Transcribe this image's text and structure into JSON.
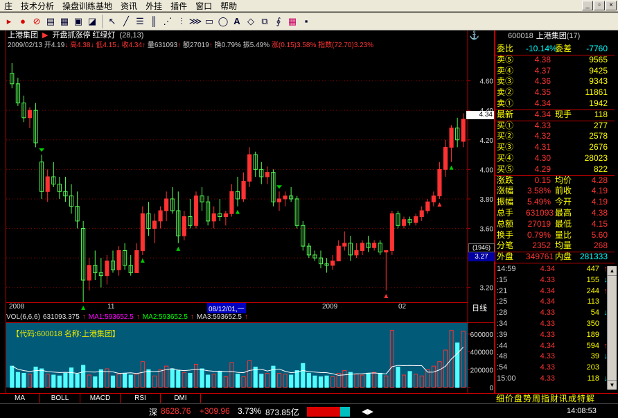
{
  "menu": {
    "items": [
      "庄",
      "技术分析",
      "操盘训练基地",
      "资讯",
      "外挂",
      "插件",
      "窗口",
      "帮助"
    ]
  },
  "window_controls": [
    "_",
    "▫",
    "×"
  ],
  "toolbar": {
    "icons": [
      "pointer-icon",
      "alarm-icon",
      "stop-icon",
      "grid-icon",
      "table-icon",
      "window-icon",
      "chart-icon",
      "cursor-icon",
      "line-icon",
      "channel-icon",
      "parallel-icon",
      "fan-icon",
      "gann-icon",
      "cycle-icon",
      "rectangle-icon",
      "ellipse-icon",
      "text-icon",
      "eraser-icon",
      "copy-icon",
      "formula-icon",
      "palette-icon",
      "save-icon"
    ]
  },
  "chart": {
    "title_stock": "上港集团",
    "title_indicator": "开盘抓涨停 红绿灯",
    "title_params": "(28,13)",
    "info_date": "2009/02/13",
    "info_open_label": "开",
    "info_open": "4.19",
    "info_high_label": "高",
    "info_high": "4.38",
    "info_low_label": "低",
    "info_low": "4.15",
    "info_close_label": "收",
    "info_close": "4.34",
    "info_vol_label": "量",
    "info_vol": "631093",
    "info_amount_label": "额",
    "info_amount": "27019",
    "info_turn_label": "换",
    "info_turn": "0.79%",
    "info_amp_label": "振",
    "info_amp": "5.49%",
    "info_chg_label": "涨",
    "info_chg": "(0.15)",
    "info_chg_pct": "3.58%",
    "info_index_label": "指数",
    "info_index": "(72.70)",
    "info_index_pct": "3.23%",
    "yaxis_labels": [
      "4.60",
      "4.40",
      "4.20",
      "4.00",
      "3.80",
      "3.60",
      "3.40",
      "3.20"
    ],
    "yaxis_values": [
      4.6,
      4.4,
      4.2,
      4.0,
      3.8,
      3.6,
      3.4,
      3.2
    ],
    "price_tag": "4.34",
    "price_tag_value": 4.34,
    "left_tag_1": "(1946)",
    "left_tag_2": "3.27",
    "xaxis_labels": [
      "2008",
      "11",
      "08/12/01,一",
      "2009",
      "02"
    ],
    "period_label": "日线",
    "vol_header": "VOL(6,6,6)",
    "vol_value": "631093.375",
    "ma1_label": "MA1:593652.5",
    "ma2_label": "MA2:593652.5",
    "ma3_label": "MA3:593652.5",
    "vol_panel_label": "【代码:600018 名称:上港集团】",
    "vol_axis_labels": [
      "600000",
      "400000",
      "200000",
      "0"
    ],
    "vol_axis_values": [
      600000,
      400000,
      200000,
      0
    ],
    "colors": {
      "up": "#ff3232",
      "down": "#54fcfc",
      "green_bar": "#54fc54",
      "grid": "#8b0000",
      "axis": "#b00000"
    }
  },
  "chart_data": [
    {
      "type": "candlestick",
      "title": "上港集团",
      "ylim": [
        3.1,
        4.8
      ],
      "ohlc": [
        [
          4.65,
          4.72,
          4.55,
          4.58
        ],
        [
          4.58,
          4.62,
          4.43,
          4.45
        ],
        [
          4.45,
          4.5,
          4.32,
          4.35
        ],
        [
          4.35,
          4.42,
          4.28,
          4.4
        ],
        [
          4.4,
          4.45,
          4.15,
          4.18
        ],
        [
          4.05,
          4.1,
          3.8,
          3.85
        ],
        [
          3.85,
          4.0,
          3.78,
          3.95
        ],
        [
          3.95,
          4.05,
          3.88,
          3.9
        ],
        [
          3.9,
          3.95,
          3.8,
          3.85
        ],
        [
          3.85,
          3.95,
          3.78,
          3.82
        ],
        [
          3.82,
          3.9,
          3.7,
          3.75
        ],
        [
          3.75,
          3.85,
          3.6,
          3.65
        ],
        [
          3.6,
          3.65,
          3.1,
          3.25
        ],
        [
          3.25,
          3.4,
          3.18,
          3.35
        ],
        [
          3.35,
          3.45,
          3.25,
          3.3
        ],
        [
          3.3,
          3.4,
          3.2,
          3.28
        ],
        [
          3.28,
          3.42,
          3.22,
          3.38
        ],
        [
          3.38,
          3.45,
          3.3,
          3.32
        ],
        [
          3.32,
          3.48,
          3.28,
          3.45
        ],
        [
          3.45,
          3.5,
          3.32,
          3.35
        ],
        [
          3.35,
          3.42,
          3.28,
          3.3
        ],
        [
          3.3,
          3.5,
          3.3,
          3.45
        ],
        [
          3.45,
          3.75,
          3.42,
          3.7
        ],
        [
          3.7,
          3.78,
          3.55,
          3.6
        ],
        [
          3.6,
          3.7,
          3.5,
          3.65
        ],
        [
          3.65,
          3.75,
          3.6,
          3.72
        ],
        [
          3.72,
          3.85,
          3.65,
          3.8
        ],
        [
          3.8,
          3.88,
          3.7,
          3.72
        ],
        [
          3.72,
          3.85,
          3.5,
          3.55
        ],
        [
          3.55,
          3.72,
          3.52,
          3.68
        ],
        [
          3.68,
          3.8,
          3.6,
          3.62
        ],
        [
          3.62,
          3.85,
          3.6,
          3.82
        ],
        [
          3.82,
          3.88,
          3.72,
          3.78
        ],
        [
          3.78,
          3.82,
          3.62,
          3.65
        ],
        [
          3.65,
          3.75,
          3.6,
          3.7
        ],
        [
          3.7,
          3.8,
          3.65,
          3.68
        ],
        [
          3.68,
          3.72,
          3.62,
          3.7
        ],
        [
          3.7,
          3.9,
          3.68,
          3.85
        ],
        [
          3.85,
          3.95,
          3.75,
          3.8
        ],
        [
          3.8,
          3.98,
          3.78,
          3.92
        ],
        [
          3.92,
          4.15,
          3.88,
          4.1
        ],
        [
          4.1,
          4.12,
          3.95,
          4.0
        ],
        [
          4.0,
          4.05,
          3.9,
          3.95
        ],
        [
          3.95,
          4.02,
          3.9,
          3.98
        ],
        [
          3.98,
          4.0,
          3.75,
          3.78
        ],
        [
          3.78,
          3.85,
          3.72,
          3.8
        ],
        [
          3.8,
          3.85,
          3.75,
          3.82
        ],
        [
          3.82,
          3.88,
          3.78,
          3.8
        ],
        [
          3.8,
          3.82,
          3.6,
          3.62
        ],
        [
          3.62,
          3.65,
          3.45,
          3.48
        ],
        [
          3.48,
          3.5,
          3.4,
          3.42
        ],
        [
          3.42,
          3.45,
          3.38,
          3.4
        ],
        [
          3.4,
          3.45,
          3.33,
          3.36
        ],
        [
          3.36,
          3.4,
          3.3,
          3.35
        ],
        [
          3.35,
          3.42,
          3.32,
          3.38
        ],
        [
          3.38,
          3.52,
          3.38,
          3.48
        ],
        [
          3.48,
          3.58,
          3.45,
          3.5
        ],
        [
          3.5,
          3.55,
          3.38,
          3.42
        ],
        [
          3.42,
          3.5,
          3.4,
          3.45
        ],
        [
          3.45,
          3.52,
          3.42,
          3.5
        ],
        [
          3.5,
          3.55,
          3.44,
          3.47
        ],
        [
          3.47,
          3.52,
          3.45,
          3.5
        ],
        [
          3.5,
          3.52,
          3.42,
          3.44
        ],
        [
          3.44,
          3.45,
          3.18,
          3.45
        ],
        [
          3.45,
          3.72,
          3.42,
          3.7
        ],
        [
          3.7,
          3.72,
          3.6,
          3.62
        ],
        [
          3.62,
          3.68,
          3.6,
          3.66
        ],
        [
          3.66,
          3.68,
          3.62,
          3.64
        ],
        [
          3.64,
          3.7,
          3.62,
          3.68
        ],
        [
          3.68,
          3.75,
          3.65,
          3.72
        ],
        [
          3.72,
          3.8,
          3.7,
          3.78
        ],
        [
          3.78,
          3.85,
          3.75,
          3.82
        ],
        [
          3.82,
          4.05,
          3.8,
          4.0
        ],
        [
          4.0,
          4.2,
          3.95,
          4.15
        ],
        [
          4.15,
          4.3,
          4.05,
          4.28
        ],
        [
          4.28,
          4.35,
          4.15,
          4.2
        ],
        [
          4.19,
          4.38,
          4.15,
          4.34
        ]
      ]
    },
    {
      "type": "bar",
      "title": "VOL(6,6,6)",
      "ylim": [
        0,
        700000
      ],
      "values": [
        240000,
        170000,
        160000,
        150000,
        230000,
        210000,
        150000,
        140000,
        130000,
        160000,
        220000,
        150000,
        250000,
        140000,
        120000,
        200000,
        210000,
        130000,
        150000,
        160000,
        140000,
        150000,
        290000,
        200000,
        130000,
        200000,
        240000,
        210000,
        190000,
        170000,
        160000,
        260000,
        210000,
        140000,
        150000,
        180000,
        120000,
        280000,
        150000,
        120000,
        300000,
        230000,
        150000,
        160000,
        240000,
        160000,
        150000,
        140000,
        190000,
        270000,
        160000,
        130000,
        120000,
        130000,
        120000,
        160000,
        190000,
        170000,
        150000,
        140000,
        160000,
        170000,
        160000,
        130000,
        640000,
        230000,
        140000,
        180000,
        150000,
        130000,
        200000,
        240000,
        290000,
        420000,
        640000,
        500000,
        631093
      ]
    }
  ],
  "right_panel": {
    "header_code": "600018",
    "header_name": "上港集团",
    "header_num": "(17)",
    "wb_label": "委比",
    "wb_value": "-10.14%",
    "wc_label": "委差",
    "wc_value": "-7760",
    "sells": [
      {
        "label": "卖⑤",
        "price": "4.38",
        "vol": "9565"
      },
      {
        "label": "卖④",
        "price": "4.37",
        "vol": "9425"
      },
      {
        "label": "卖③",
        "price": "4.36",
        "vol": "9343"
      },
      {
        "label": "卖②",
        "price": "4.35",
        "vol": "11861"
      },
      {
        "label": "卖①",
        "price": "4.34",
        "vol": "1942"
      }
    ],
    "latest_label": "最新",
    "latest_price": "4.34",
    "xianshou_label": "现手",
    "xianshou": "118",
    "buys": [
      {
        "label": "买①",
        "price": "4.33",
        "vol": "277"
      },
      {
        "label": "买②",
        "price": "4.32",
        "vol": "2578"
      },
      {
        "label": "买③",
        "price": "4.31",
        "vol": "2676"
      },
      {
        "label": "买④",
        "price": "4.30",
        "vol": "28023"
      },
      {
        "label": "买⑤",
        "price": "4.29",
        "vol": "822"
      }
    ],
    "stats": [
      {
        "l1": "涨跌",
        "v1": "0.15",
        "l2": "均价",
        "v2": "4.28"
      },
      {
        "l1": "涨幅",
        "v1": "3.58%",
        "l2": "前收",
        "v2": "4.19"
      },
      {
        "l1": "振幅",
        "v1": "5.49%",
        "l2": "今开",
        "v2": "4.19"
      },
      {
        "l1": "总手",
        "v1": "631093",
        "l2": "最高",
        "v2": "4.38"
      },
      {
        "l1": "总额",
        "v1": "27019",
        "l2": "最低",
        "v2": "4.15"
      },
      {
        "l1": "换手",
        "v1": "0.79%",
        "l2": "量比",
        "v2": "5.60"
      },
      {
        "l1": "分笔",
        "v1": "2352",
        "l2": "均量",
        "v2": "268"
      }
    ],
    "wp_label": "外盘",
    "wp_value": "349761",
    "np_label": "内盘",
    "np_value": "281333",
    "ticks": [
      {
        "t": "14:59",
        "p": "4.34",
        "v": "447",
        "d": "↑"
      },
      {
        "t": ":15",
        "p": "4.33",
        "v": "155",
        "d": "↓"
      },
      {
        "t": ":21",
        "p": "4.34",
        "v": "244",
        "d": "↑"
      },
      {
        "t": ":25",
        "p": "4.34",
        "v": "113",
        "d": ""
      },
      {
        "t": ":28",
        "p": "4.33",
        "v": "54",
        "d": "↓"
      },
      {
        "t": ":34",
        "p": "4.33",
        "v": "350",
        "d": ""
      },
      {
        "t": ":39",
        "p": "4.33",
        "v": "189",
        "d": ""
      },
      {
        "t": ":44",
        "p": "4.34",
        "v": "594",
        "d": "↑"
      },
      {
        "t": ":48",
        "p": "4.33",
        "v": "39",
        "d": "↓"
      },
      {
        "t": ":54",
        "p": "4.33",
        "v": "203",
        "d": ""
      },
      {
        "t": "15:00",
        "p": "4.33",
        "v": "118",
        "d": "↓"
      }
    ],
    "bottom_tabs": "细价盘势周指财讯成特解"
  },
  "bottom_tabs": [
    "MA",
    "BOLL",
    "MACD",
    "RSI",
    "DMI"
  ],
  "status": {
    "index_name": "深",
    "index_value": "8628.76",
    "index_change": "+309.96",
    "index_pct": "3.73%",
    "index_amount": "873.85亿",
    "time": "14:08:53"
  }
}
